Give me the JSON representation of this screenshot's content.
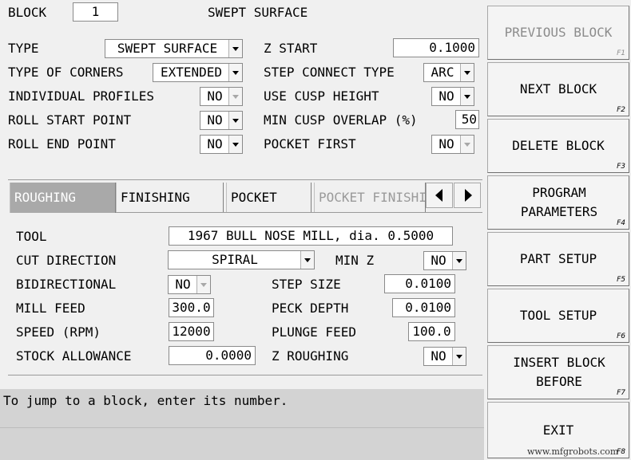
{
  "header": {
    "block_label": "BLOCK",
    "block_number": "1",
    "title": "SWEPT SURFACE"
  },
  "params": {
    "type_label": "TYPE",
    "type_value": "SWEPT SURFACE",
    "corners_label": "TYPE OF CORNERS",
    "corners_value": "EXTENDED",
    "indiv_label": "INDIVIDUAL PROFILES",
    "indiv_value": "NO",
    "roll_start_label": "ROLL START POINT",
    "roll_start_value": "NO",
    "roll_end_label": "ROLL END POINT",
    "roll_end_value": "NO",
    "zstart_label": "Z START",
    "zstart_value": "0.1000",
    "step_connect_label": "STEP CONNECT TYPE",
    "step_connect_value": "ARC",
    "cusp_label": "USE CUSP HEIGHT",
    "cusp_value": "NO",
    "overlap_label": "MIN CUSP OVERLAP (%)",
    "overlap_value": "50",
    "pocket_first_label": "POCKET FIRST",
    "pocket_first_value": "NO"
  },
  "tabs": [
    "ROUGHING",
    "FINISHING",
    "POCKET",
    "POCKET FINISHI"
  ],
  "rough": {
    "tool_label": "TOOL",
    "tool_value": "1967 BULL NOSE MILL, dia. 0.5000",
    "cut_dir_label": "CUT DIRECTION",
    "cut_dir_value": "SPIRAL",
    "minz_label": "MIN Z",
    "minz_value": "NO",
    "bidir_label": "BIDIRECTIONAL",
    "bidir_value": "NO",
    "step_label": "STEP SIZE",
    "step_value": "0.0100",
    "feed_label": "MILL FEED",
    "feed_value": "300.0",
    "peck_label": "PECK DEPTH",
    "peck_value": "0.0100",
    "speed_label": "SPEED (RPM)",
    "speed_value": "12000",
    "plunge_label": "PLUNGE FEED",
    "plunge_value": "100.0",
    "stock_label": "STOCK ALLOWANCE",
    "stock_value": "0.0000",
    "zrough_label": "Z ROUGHING",
    "zrough_value": "NO"
  },
  "status": {
    "message": "To jump to a block, enter its number."
  },
  "sidebar": [
    {
      "label": "PREVIOUS BLOCK",
      "key": "F1"
    },
    {
      "label": "NEXT BLOCK",
      "key": "F2"
    },
    {
      "label": "DELETE BLOCK",
      "key": "F3"
    },
    {
      "label": "PROGRAM PARAMETERS",
      "key": "F4"
    },
    {
      "label": "PART SETUP",
      "key": "F5"
    },
    {
      "label": "TOOL SETUP",
      "key": "F6"
    },
    {
      "label": "INSERT BLOCK BEFORE",
      "key": "F7"
    },
    {
      "label": "EXIT",
      "key": "F8"
    }
  ],
  "watermark": "www.mfgrobots.com"
}
